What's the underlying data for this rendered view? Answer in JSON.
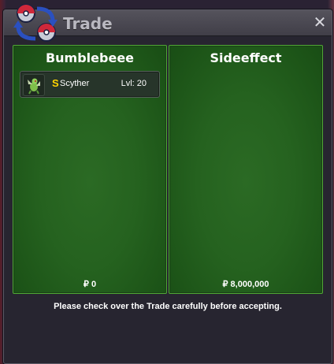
{
  "window": {
    "title": "Trade",
    "close_glyph": "✕"
  },
  "colors": {
    "panel_green": "#25621f",
    "panel_border": "#4fa835",
    "window_bg": "#272530",
    "titlebar": "#4a4852",
    "shiny_gold": "#ffd400"
  },
  "left_panel": {
    "player_name": "Bumblebeee",
    "items": [
      {
        "icon": "scyther-icon",
        "shiny_marker": "S",
        "name": "Scyther",
        "level": "Lvl: 20"
      }
    ],
    "money": "₽ 0"
  },
  "right_panel": {
    "player_name": "Sideeffect",
    "items": [],
    "money": "₽ 8,000,000"
  },
  "footer": {
    "note": "Please check over the Trade carefully before accepting."
  }
}
